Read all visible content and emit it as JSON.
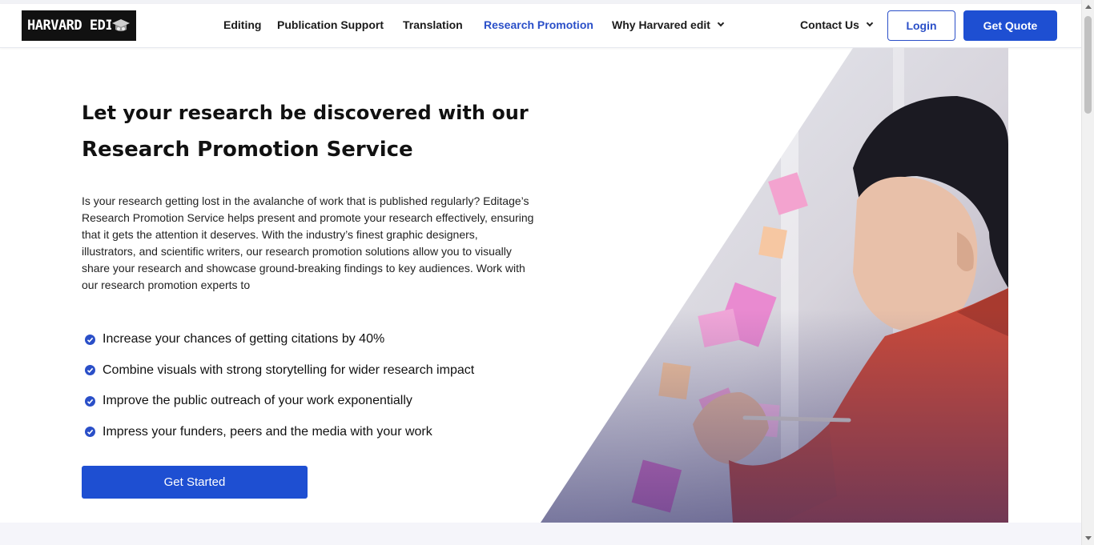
{
  "header": {
    "logo_text": "HARVARD EDIT",
    "nav": [
      {
        "label": "Editing",
        "active": false,
        "dropdown": false
      },
      {
        "label": "Publication Support",
        "active": false,
        "dropdown": false
      },
      {
        "label": "Translation",
        "active": false,
        "dropdown": false
      },
      {
        "label": "Research Promotion",
        "active": true,
        "dropdown": false
      },
      {
        "label": "Why Harvared edit",
        "active": false,
        "dropdown": true
      }
    ],
    "contact_label": "Contact Us",
    "login_label": "Login",
    "quote_label": "Get Quote"
  },
  "hero": {
    "title_line1": "Let your research be discovered with our",
    "title_line2": "Research Promotion Service",
    "description": "Is your research getting lost in the avalanche of work that is published regularly? Editage’s Research Promotion Service helps present and promote your research effectively, ensuring that it gets the attention it deserves. With the industry’s finest graphic designers, illustrators, and scientific writers, our research promotion solutions allow you to visually share your research and showcase ground-breaking findings to key audiences. Work with our research promotion experts to",
    "bullets": [
      "Increase your chances of getting citations by 40%",
      "Combine visuals with strong storytelling for wider research impact",
      "Improve the public outreach of your work exponentially",
      "Impress your funders, peers and the media with your work"
    ],
    "cta_label": "Get Started"
  },
  "colors": {
    "accent": "#1e4fd2",
    "active_nav": "#2a4fc8",
    "check": "#2a4fc8"
  },
  "icons": {
    "logo_mark": "graduation-cap-icon",
    "bullet": "check-circle-icon",
    "dropdown": "chevron-down-icon"
  }
}
